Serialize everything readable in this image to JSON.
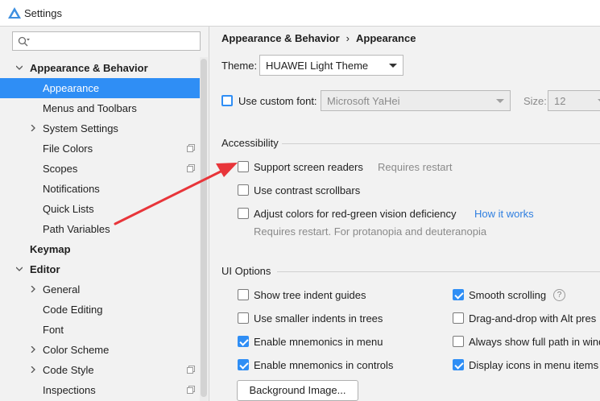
{
  "window": {
    "title": "Settings"
  },
  "sidebar": {
    "search": {
      "placeholder": "",
      "value": ""
    },
    "items": [
      {
        "label": "Appearance & Behavior",
        "level": 0,
        "expanded": true,
        "bold": true
      },
      {
        "label": "Appearance",
        "level": 1,
        "selected": true
      },
      {
        "label": "Menus and Toolbars",
        "level": 1
      },
      {
        "label": "System Settings",
        "level": 1,
        "collapsible": true
      },
      {
        "label": "File Colors",
        "level": 1,
        "badge": true
      },
      {
        "label": "Scopes",
        "level": 1,
        "badge": true
      },
      {
        "label": "Notifications",
        "level": 1
      },
      {
        "label": "Quick Lists",
        "level": 1
      },
      {
        "label": "Path Variables",
        "level": 1
      },
      {
        "label": "Keymap",
        "level": 0,
        "bold": true
      },
      {
        "label": "Editor",
        "level": 0,
        "expanded": true,
        "bold": true
      },
      {
        "label": "General",
        "level": 1,
        "collapsible": true
      },
      {
        "label": "Code Editing",
        "level": 1
      },
      {
        "label": "Font",
        "level": 1
      },
      {
        "label": "Color Scheme",
        "level": 1,
        "collapsible": true
      },
      {
        "label": "Code Style",
        "level": 1,
        "collapsible": true,
        "badge": true
      },
      {
        "label": "Inspections",
        "level": 1,
        "badge": true
      }
    ]
  },
  "main": {
    "breadcrumb": {
      "parent": "Appearance & Behavior",
      "separator": "›",
      "current": "Appearance"
    },
    "theme": {
      "label": "Theme:",
      "value": "HUAWEI Light Theme"
    },
    "custom_font": {
      "checkbox_label": "Use custom font:",
      "checked": false,
      "font_value": "Microsoft YaHei",
      "size_label": "Size:",
      "size_value": "12"
    },
    "accessibility": {
      "title": "Accessibility",
      "screen_readers": {
        "label": "Support screen readers",
        "checked": false,
        "hint": "Requires restart"
      },
      "contrast_scrollbars": {
        "label": "Use contrast scrollbars",
        "checked": false
      },
      "color_deficiency": {
        "label": "Adjust colors for red-green vision deficiency",
        "checked": false,
        "link": "How it works",
        "hint": "Requires restart. For protanopia and deuteranopia"
      }
    },
    "ui_options": {
      "title": "UI Options",
      "left": [
        {
          "label": "Show tree indent guides",
          "checked": false
        },
        {
          "label": "Use smaller indents in trees",
          "checked": false
        },
        {
          "label": "Enable mnemonics in menu",
          "checked": true
        },
        {
          "label": "Enable mnemonics in controls",
          "checked": true
        }
      ],
      "right": [
        {
          "label": "Smooth scrolling",
          "checked": true,
          "help": "?"
        },
        {
          "label": "Drag-and-drop with Alt pres",
          "checked": false
        },
        {
          "label": "Always show full path in wind",
          "checked": false
        },
        {
          "label": "Display icons in menu items",
          "checked": true
        }
      ],
      "background_button": "Background Image..."
    }
  },
  "annotation": {
    "arrow_color": "#e8353a"
  }
}
